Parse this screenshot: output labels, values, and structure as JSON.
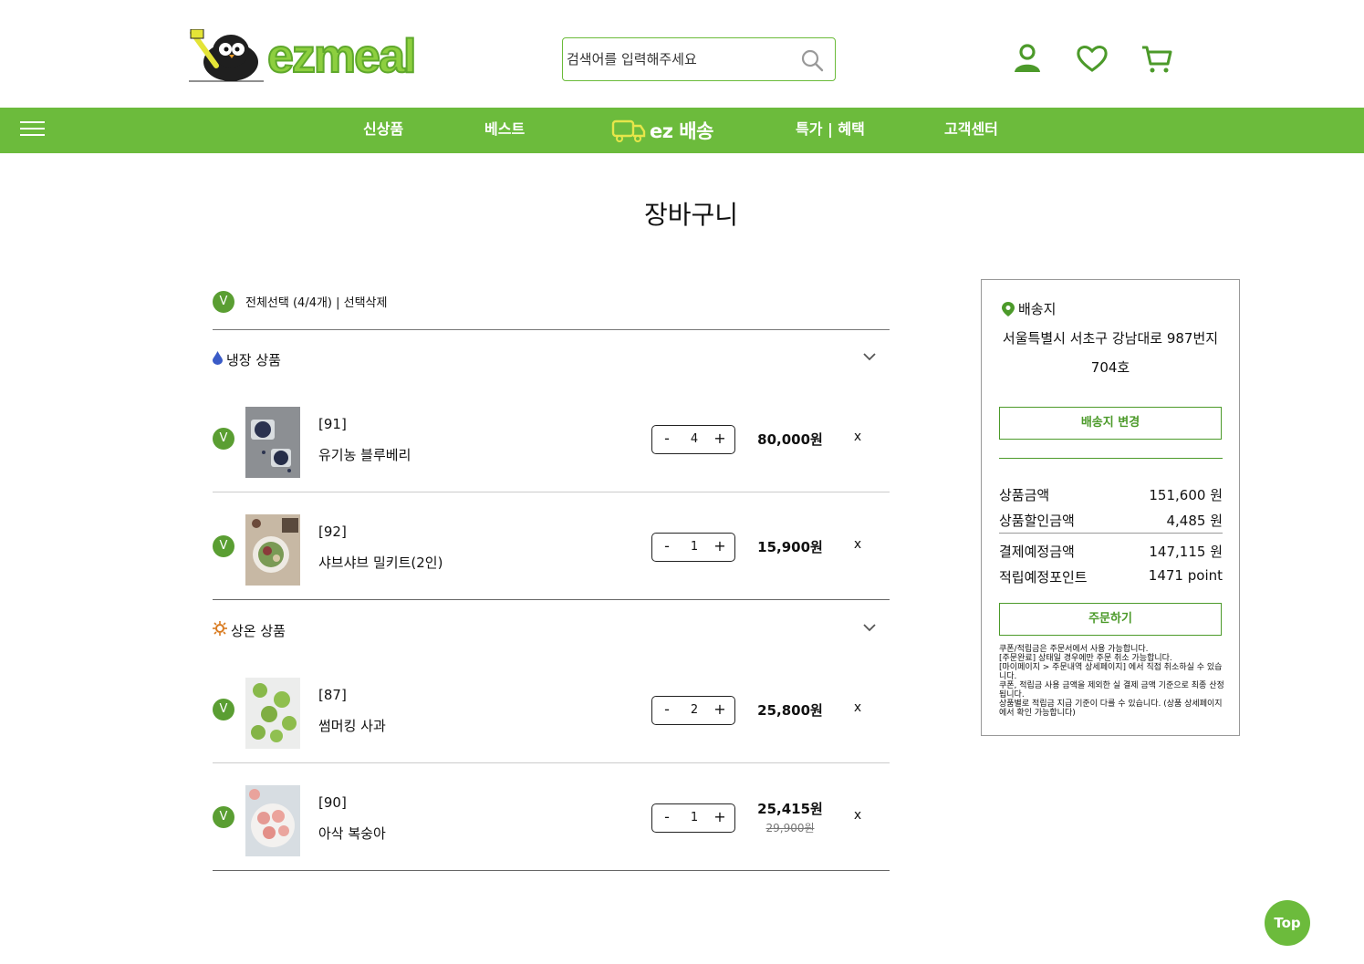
{
  "header": {
    "logo_text": "ezmeal",
    "search_placeholder": "검색어를 입력해주세요",
    "icons": [
      "user-icon",
      "heart-icon",
      "cart-icon"
    ]
  },
  "nav": {
    "items": [
      "신상품",
      "베스트",
      "ez 배송",
      "특가 | 혜택",
      "고객센터"
    ]
  },
  "page_title": "장바구니",
  "cart": {
    "select_all": "전체선택 (4/4개)  |  선택삭제",
    "checkbox_mark": "V",
    "sections": [
      {
        "label": "냉장 상품",
        "icon": "water-drop-icon",
        "items": [
          {
            "code": "[91]",
            "name": "유기농 블루베리",
            "qty": "4",
            "price": "80,000원"
          },
          {
            "code": "[92]",
            "name": "샤브샤브 밀키트(2인)",
            "qty": "1",
            "price": "15,900원"
          }
        ]
      },
      {
        "label": "상온 상품",
        "icon": "sun-icon",
        "items": [
          {
            "code": "[87]",
            "name": "썸머킹 사과",
            "qty": "2",
            "price": "25,800원"
          },
          {
            "code": "[90]",
            "name": "아삭 복숭아",
            "qty": "1",
            "price": "25,415원",
            "original_price": "29,900원"
          }
        ]
      }
    ],
    "minus_label": "-",
    "plus_label": "+",
    "remove_label": "x"
  },
  "summary": {
    "ship_label": "배송지",
    "address": "서울특별시 서초구 강남대로 987번지 704호",
    "change_button": "배송지 변경",
    "rows": [
      {
        "label": "상품금액",
        "value": "151,600 원"
      },
      {
        "label": "상품할인금액",
        "value": "4,485 원"
      },
      {
        "label": "결제예정금액",
        "value": "147,115 원"
      },
      {
        "label": "적립예정포인트",
        "value": "1471 point"
      }
    ],
    "order_button": "주문하기",
    "notes": [
      "쿠폰/적립금은 주문서에서 사용 가능합니다.",
      "[주문완료] 상태일 경우에만 주문 취소 가능합니다.",
      "[마이페이지 > 주문내역 상세페이지] 에서 직접 취소하실 수 있습니다.",
      "쿠폰, 적립금 사용 금액을 제외한 실 결제 금액 기준으로 최종 산정됩니다.",
      "상품별로 적립금 지급 기준이 다를 수 있습니다. (상품 상세페이지에서 확인 가능합니다)"
    ]
  },
  "top_button": "Top",
  "colors": {
    "brand_green": "#6cbb3c",
    "dark_green": "#4c9a2a",
    "checkbox_green": "#5a9e32"
  }
}
